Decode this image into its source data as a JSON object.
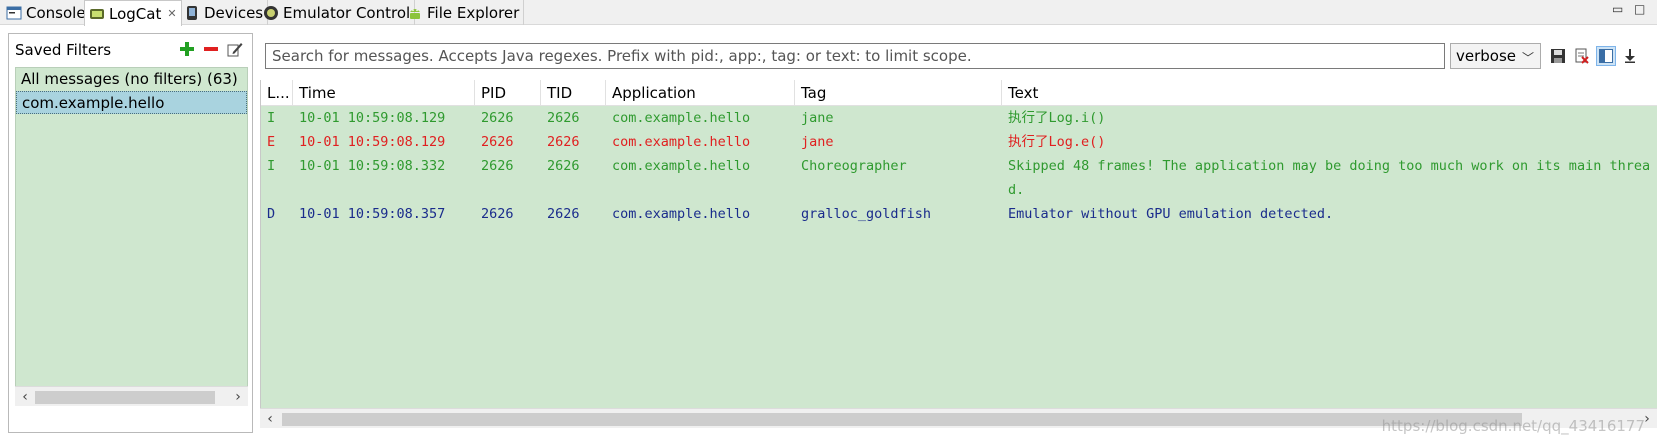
{
  "tabs": [
    {
      "label": "Console",
      "icon": "console-icon",
      "active": false
    },
    {
      "label": "LogCat",
      "icon": "logcat-icon",
      "active": true
    },
    {
      "label": "Devices",
      "icon": "devices-icon",
      "active": false
    },
    {
      "label": "Emulator Control",
      "icon": "emulator-control-icon",
      "active": false
    },
    {
      "label": "File Explorer",
      "icon": "android-icon",
      "active": false
    }
  ],
  "filters": {
    "title": "Saved Filters",
    "items": [
      {
        "label": "All messages (no filters) (63)",
        "selected": false
      },
      {
        "label": "com.example.hello",
        "selected": true
      }
    ]
  },
  "search": {
    "placeholder": "Search for messages. Accepts Java regexes. Prefix with pid:, app:, tag: or text: to limit scope."
  },
  "level": {
    "value": "verbose"
  },
  "table": {
    "columns": [
      "L...",
      "Time",
      "PID",
      "TID",
      "Application",
      "Tag",
      "Text"
    ],
    "rows": [
      {
        "level": "I",
        "time": "10-01 10:59:08.129",
        "pid": "2626",
        "tid": "2626",
        "app": "com.example.hello",
        "tag": "jane",
        "text": "执行了Log.i()",
        "color": "#2f9a2f"
      },
      {
        "level": "E",
        "time": "10-01 10:59:08.129",
        "pid": "2626",
        "tid": "2626",
        "app": "com.example.hello",
        "tag": "jane",
        "text": "执行了Log.e()",
        "color": "#e02020"
      },
      {
        "level": "I",
        "time": "10-01 10:59:08.332",
        "pid": "2626",
        "tid": "2626",
        "app": "com.example.hello",
        "tag": "Choreographer",
        "text": "Skipped 48 frames!  The application may be doing too much work on its main thread.",
        "color": "#2f9a2f"
      },
      {
        "level": "D",
        "time": "10-01 10:59:08.357",
        "pid": "2626",
        "tid": "2626",
        "app": "com.example.hello",
        "tag": "gralloc_goldfish",
        "text": "Emulator without GPU emulation detected.",
        "color": "#1a2c8c"
      }
    ]
  },
  "colors": {
    "row_background": "#cfe7cf",
    "selected_filter": "#a9d3df",
    "info": "#2f9a2f",
    "error": "#e02020",
    "debug": "#1a2c8c"
  },
  "watermark": "https://blog.csdn.net/qq_43416177"
}
